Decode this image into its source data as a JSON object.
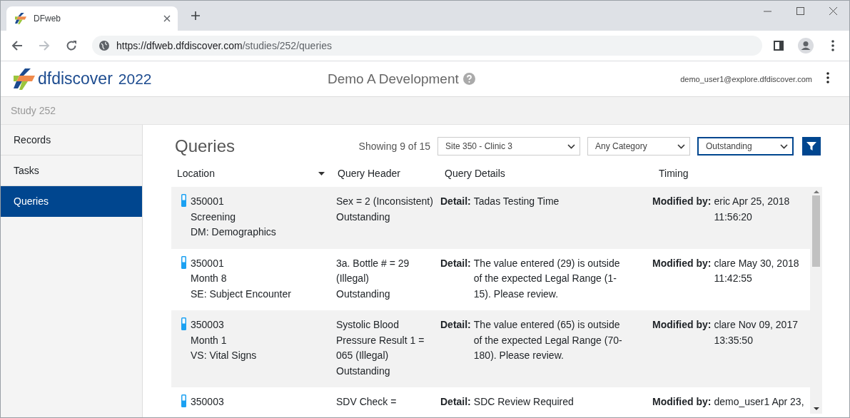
{
  "browser": {
    "tab_title": "DFweb",
    "url_host": "https://dfweb.dfdiscover.com",
    "url_path": "/studies/252/queries"
  },
  "header": {
    "logo_name": "dfdiscover",
    "logo_year": "2022",
    "study_title": "Demo A Development",
    "user_email": "demo_user1@explore.dfdiscover.com"
  },
  "breadcrumb": "Study 252",
  "sidebar": {
    "items": [
      {
        "label": "Records",
        "selected": false
      },
      {
        "label": "Tasks",
        "selected": false
      },
      {
        "label": "Queries",
        "selected": true
      }
    ]
  },
  "content": {
    "title": "Queries",
    "showing": "Showing 9 of 15",
    "filters": [
      {
        "value": "Site 350 - Clinic 3",
        "focused": false
      },
      {
        "value": "Any Category",
        "focused": false
      },
      {
        "value": "Outstanding",
        "focused": true
      }
    ],
    "columns": [
      {
        "label": "Location",
        "sortable": true
      },
      {
        "label": "Query Header",
        "sortable": false
      },
      {
        "label": "Query Details",
        "sortable": false
      },
      {
        "label": "Timing",
        "sortable": false
      }
    ],
    "rows": [
      {
        "location": [
          "350001",
          "Screening",
          "DM: Demographics"
        ],
        "header": [
          "Sex = 2 (Inconsistent)",
          "Outstanding"
        ],
        "detail_label": "Detail:",
        "detail": "Tadas Testing Time",
        "timing_label": "Modified by:",
        "timing": "eric Apr 25, 2018 11:56:20"
      },
      {
        "location": [
          "350001",
          "Month 8",
          "SE: Subject Encounter"
        ],
        "header": [
          "3a. Bottle # = 29 (Illegal)",
          "Outstanding"
        ],
        "detail_label": "Detail:",
        "detail": "The value entered (29) is outside of the expected Legal Range (1-15). Please review.",
        "timing_label": "Modified by:",
        "timing": "clare May 30, 2018 11:42:55"
      },
      {
        "location": [
          "350003",
          "Month 1",
          "VS: Vital Signs"
        ],
        "header": [
          "Systolic Blood Pressure Result 1 = 065 (Illegal)",
          "Outstanding"
        ],
        "detail_label": "Detail:",
        "detail": "The value entered (65) is outside of the expected Legal Range (70-180). Please review.",
        "timing_label": "Modified by:",
        "timing": "clare Nov 09, 2017 13:35:50"
      },
      {
        "location": [
          "350003"
        ],
        "header": [
          "SDV Check ="
        ],
        "detail_label": "Detail:",
        "detail": "SDC Review Required",
        "timing_label": "Modified by:",
        "timing": "demo_user1 Apr 23,"
      }
    ]
  }
}
